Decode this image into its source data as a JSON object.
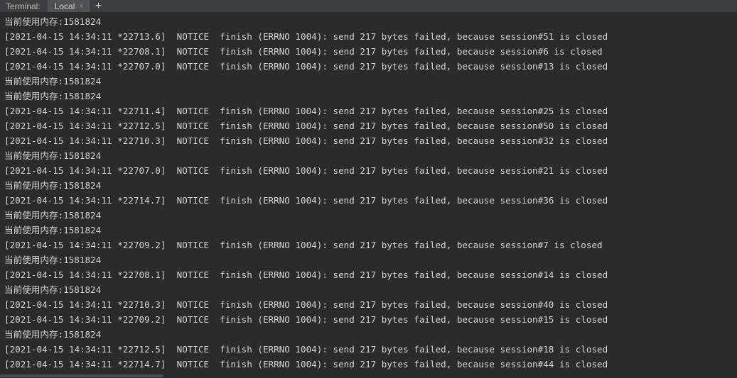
{
  "tabbar": {
    "label": "Terminal:",
    "tab_label": "Local",
    "close_glyph": "×",
    "add_glyph": "+"
  },
  "terminal": {
    "lines": [
      "当前使用内存:1581824",
      "[2021-04-15 14:34:11 *22713.6]  NOTICE  finish (ERRNO 1004): send 217 bytes failed, because session#51 is closed",
      "[2021-04-15 14:34:11 *22708.1]  NOTICE  finish (ERRNO 1004): send 217 bytes failed, because session#6 is closed",
      "[2021-04-15 14:34:11 *22707.0]  NOTICE  finish (ERRNO 1004): send 217 bytes failed, because session#13 is closed",
      "当前使用内存:1581824",
      "当前使用内存:1581824",
      "[2021-04-15 14:34:11 *22711.4]  NOTICE  finish (ERRNO 1004): send 217 bytes failed, because session#25 is closed",
      "[2021-04-15 14:34:11 *22712.5]  NOTICE  finish (ERRNO 1004): send 217 bytes failed, because session#50 is closed",
      "[2021-04-15 14:34:11 *22710.3]  NOTICE  finish (ERRNO 1004): send 217 bytes failed, because session#32 is closed",
      "当前使用内存:1581824",
      "[2021-04-15 14:34:11 *22707.0]  NOTICE  finish (ERRNO 1004): send 217 bytes failed, because session#21 is closed",
      "当前使用内存:1581824",
      "[2021-04-15 14:34:11 *22714.7]  NOTICE  finish (ERRNO 1004): send 217 bytes failed, because session#36 is closed",
      "当前使用内存:1581824",
      "当前使用内存:1581824",
      "[2021-04-15 14:34:11 *22709.2]  NOTICE  finish (ERRNO 1004): send 217 bytes failed, because session#7 is closed",
      "当前使用内存:1581824",
      "[2021-04-15 14:34:11 *22708.1]  NOTICE  finish (ERRNO 1004): send 217 bytes failed, because session#14 is closed",
      "当前使用内存:1581824",
      "[2021-04-15 14:34:11 *22710.3]  NOTICE  finish (ERRNO 1004): send 217 bytes failed, because session#40 is closed",
      "[2021-04-15 14:34:11 *22709.2]  NOTICE  finish (ERRNO 1004): send 217 bytes failed, because session#15 is closed",
      "当前使用内存:1581824",
      "[2021-04-15 14:34:11 *22712.5]  NOTICE  finish (ERRNO 1004): send 217 bytes failed, because session#18 is closed",
      "[2021-04-15 14:34:11 *22714.7]  NOTICE  finish (ERRNO 1004): send 217 bytes failed, because session#44 is closed"
    ]
  }
}
